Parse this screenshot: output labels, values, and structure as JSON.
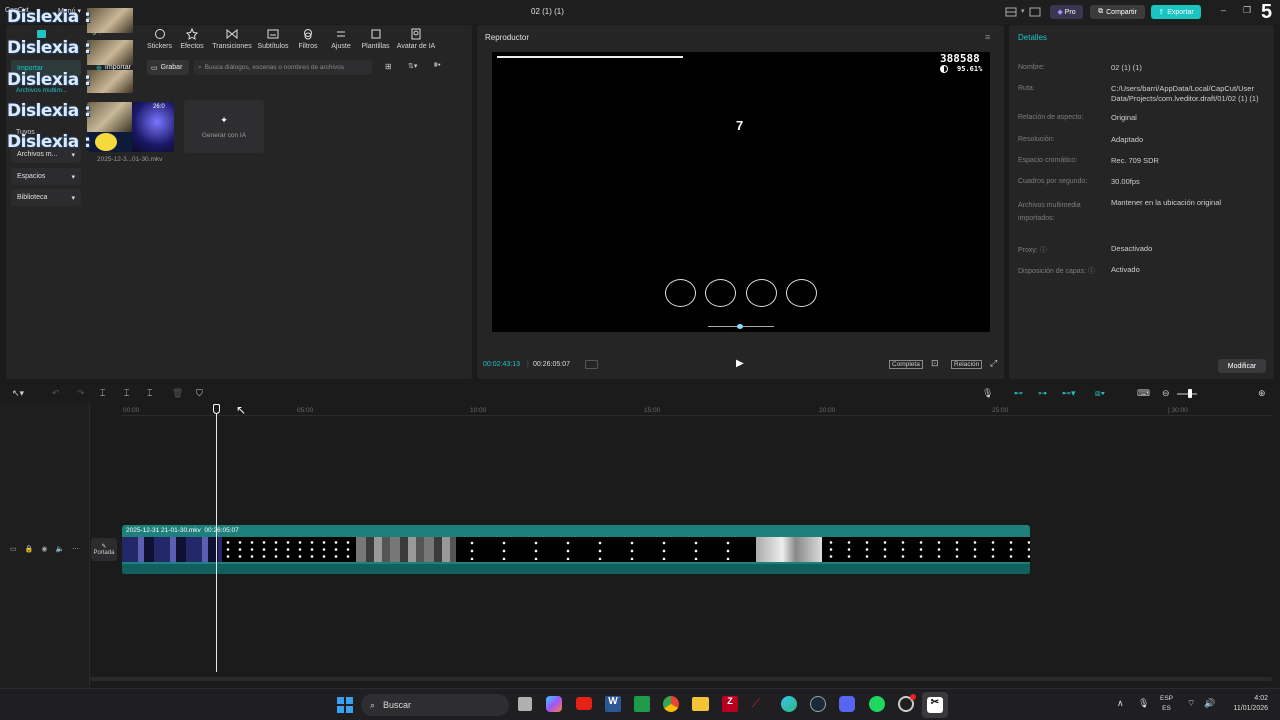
{
  "window": {
    "app_name": "CapCut",
    "menu_label": "Menú",
    "title": "02 (1) (1)",
    "pro_label": "Pro",
    "share_label": "Compartir",
    "export_label": "Exportar",
    "corner_number": "5"
  },
  "toolbar_tabs": [
    "Stickers",
    "Efectos",
    "Transiciones",
    "Subtítulos",
    "Filtros",
    "Ajuste",
    "Plantillas",
    "Avatar de IA"
  ],
  "media": {
    "import_label": "Importar",
    "record_label": "Grabar",
    "search_placeholder": "Busca diálogos, escenas o nombres de archivos",
    "clip_name": "2025-12-3...01-30.mkv",
    "clip_badge": "26:0",
    "generate_ai_label": "Generar con IA"
  },
  "sidebar": {
    "overlay_text": "Dislexia :",
    "items": [
      "Importar",
      "Archivos multim...",
      "Tuyos",
      "Archivos m...",
      "Espacios",
      "Biblioteca"
    ]
  },
  "player": {
    "title": "Reproductor",
    "score": "388588",
    "percent": "95.61%",
    "center_number": "7",
    "current_time": "00:02:43:13",
    "total_time": "00:26:05:07",
    "full_label": "Completa",
    "ratio_label": "Relación"
  },
  "details": {
    "title": "Detalles",
    "modify_label": "Modificar",
    "rows": [
      {
        "label": "Nombre:",
        "value": "02 (1) (1)"
      },
      {
        "label": "Ruta:",
        "value": "C:/Users/barri/AppData/Local/CapCut/User Data/Projects/com.lveditor.draft/01/02 (1) (1)"
      },
      {
        "label": "Relación de aspecto:",
        "value": "Original"
      },
      {
        "label": "Resolución:",
        "value": "Adaptado"
      },
      {
        "label": "Espacio cromático:",
        "value": "Rec. 709 SDR"
      },
      {
        "label": "Cuadros por segundo:",
        "value": "30.00fps"
      },
      {
        "label": "Archivos multimedia importados:",
        "value": "Mantener en la ubicación original"
      },
      {
        "label": "Proxy:",
        "value": "Desactivado"
      },
      {
        "label": "Disposición de capas:",
        "value": "Activado"
      }
    ]
  },
  "timeline": {
    "ruler": [
      "00:00",
      "05:00",
      "10:00",
      "15:00",
      "20:00",
      "25:00"
    ],
    "clip_title": "2025-12-31 21-01-30.mkv",
    "clip_duration": "00:26:05:07",
    "cover_label": "Portada"
  },
  "taskbar": {
    "search_label": "Buscar",
    "lang_top": "ESP",
    "lang_bottom": "ES",
    "time": "4:02",
    "date": "11/01/2026"
  },
  "colors": {
    "accent": "#20c4c4",
    "export_bg": "#18c5c0",
    "clip_bar": "#1e7f7d",
    "pro_bg": "#3a3550"
  }
}
